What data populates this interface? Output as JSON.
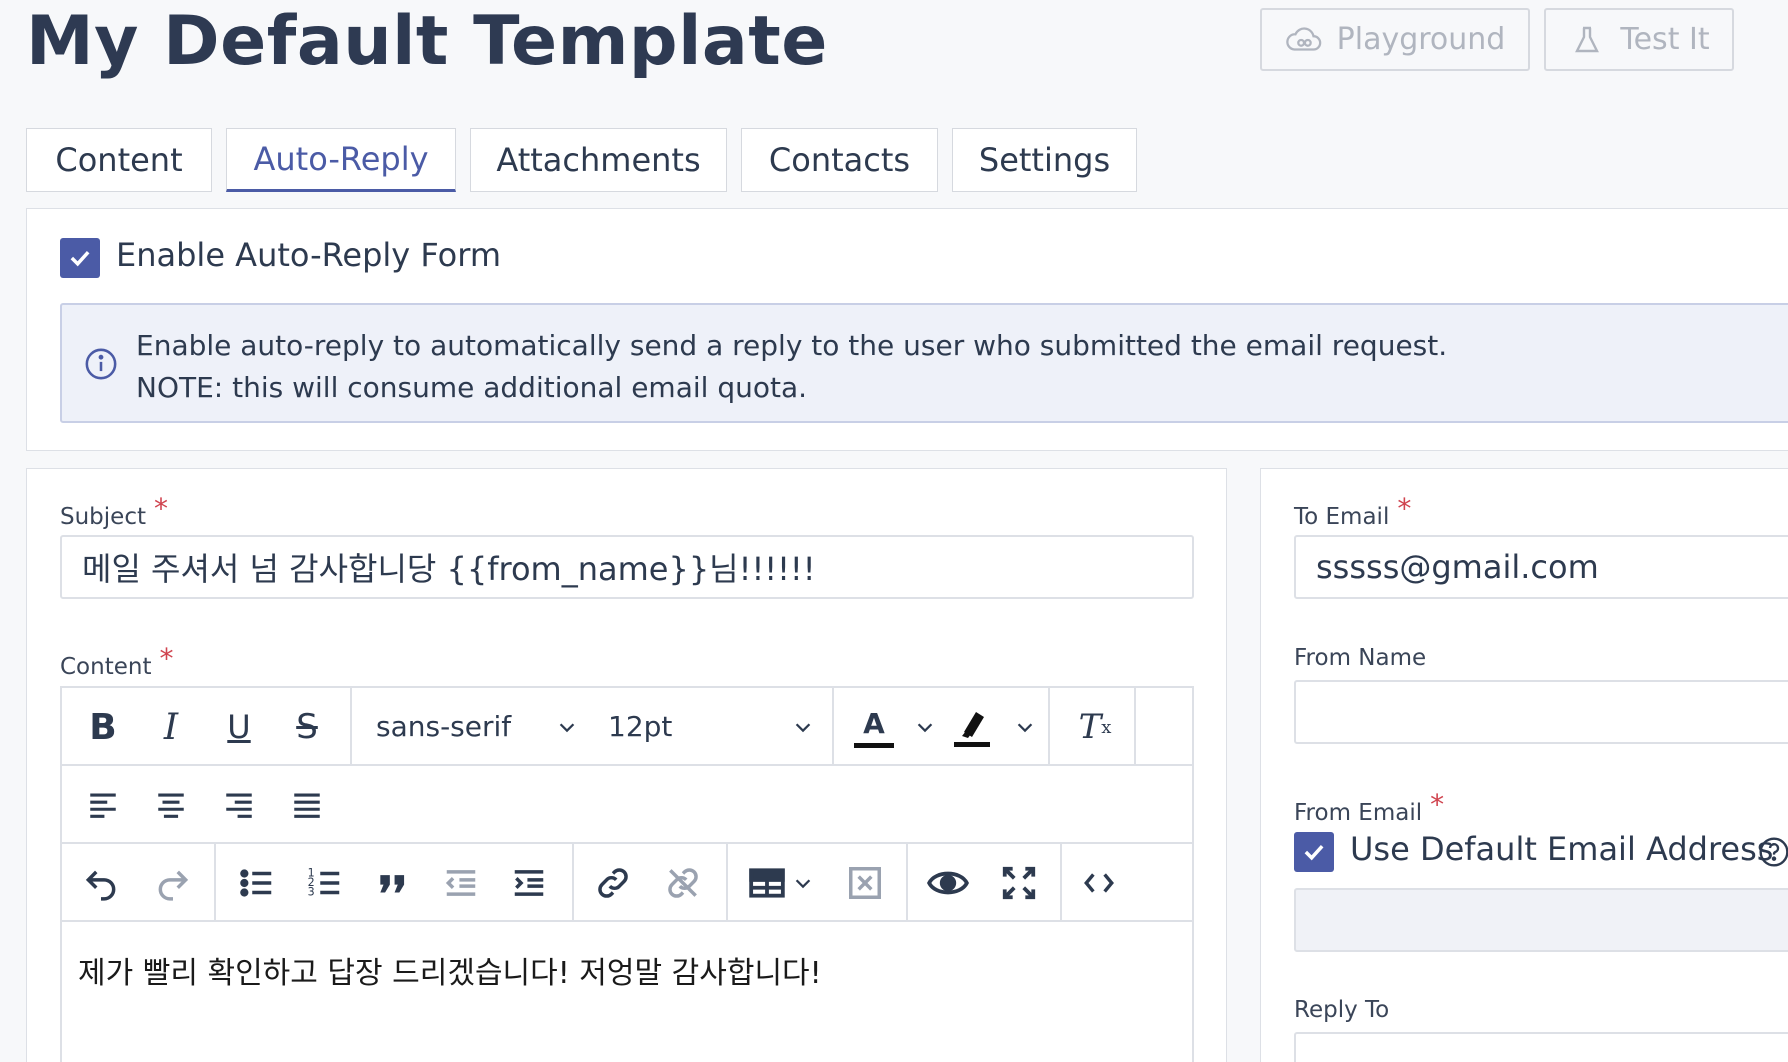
{
  "page": {
    "title": "My Default Template"
  },
  "header": {
    "playground_label": "Playground",
    "test_label": "Test It"
  },
  "tabs": [
    {
      "label": "Content",
      "active": false
    },
    {
      "label": "Auto-Reply",
      "active": true
    },
    {
      "label": "Attachments",
      "active": false
    },
    {
      "label": "Contacts",
      "active": false
    },
    {
      "label": "Settings",
      "active": false
    }
  ],
  "autoreply": {
    "enable_label": "Enable Auto-Reply Form",
    "enabled": true,
    "info_line1": "Enable auto-reply to automatically send a reply to the user who submitted the email request.",
    "info_line2": "NOTE: this will consume additional email quota."
  },
  "form": {
    "subject_label": "Subject",
    "subject_value": "메일 주셔서 넘 감사합니당 {{from_name}}님!!!!!!",
    "content_label": "Content",
    "content_value": "제가 빨리 확인하고 답장 드리겠습니다! 저엉말 감사합니다!",
    "font_family": "sans-serif",
    "font_size": "12pt",
    "required_mark": "*"
  },
  "sidebar": {
    "to_email_label": "To Email",
    "to_email_value": "sssss@gmail.com",
    "from_name_label": "From Name",
    "from_name_value": "",
    "from_email_label": "From Email",
    "use_default_label": "Use Default Email Address",
    "use_default_checked": true,
    "reply_to_label": "Reply To"
  },
  "colors": {
    "accent": "#4b5ba6",
    "required": "#d0444f",
    "info_bg": "#eef1f9"
  }
}
